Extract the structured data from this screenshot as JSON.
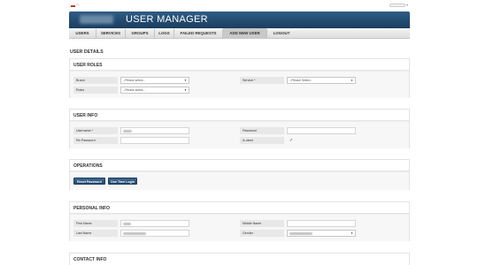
{
  "header": {
    "title": "USER MANAGER"
  },
  "nav": [
    {
      "label": "USERS"
    },
    {
      "label": "SERVICES"
    },
    {
      "label": "GROUPS"
    },
    {
      "label": "LOGS"
    },
    {
      "label": "FAILED REQUESTS"
    },
    {
      "label": "ADD NEW USER",
      "active": true
    },
    {
      "label": "LOGOUT"
    }
  ],
  "page": {
    "heading": "USER DETAILS"
  },
  "roles": {
    "title": "USER ROLES",
    "brand_label": "Brand",
    "brand_value": "--Please select--",
    "service_label": "Service *",
    "service_value": "--Please Select--",
    "roles_label": "Roles",
    "roles_value": "--Please select--"
  },
  "info": {
    "title": "USER INFO",
    "username_label": "Username *",
    "password_label": "Password",
    "repassword_label": "Re-Password",
    "isclient_label": "Is client",
    "isclient_checked": true,
    "check_glyph": "✓"
  },
  "ops": {
    "title": "OPERATIONS",
    "reset_label": "Reset Password",
    "onetime_label": "One Time Login"
  },
  "personal": {
    "title": "PERSONAL INFO",
    "firstname_label": "First Name",
    "middlename_label": "Middle Name",
    "lastname_label": "Last Name",
    "gender_label": "Gender"
  },
  "contact": {
    "title": "CONTACT INFO"
  },
  "icons": {
    "dropdown": "chevron-down-icon",
    "flag": "flag-icon"
  },
  "colors": {
    "banner": "#1b3e5f",
    "button": "#2c5479",
    "nav_active": "#c9c9c9"
  }
}
